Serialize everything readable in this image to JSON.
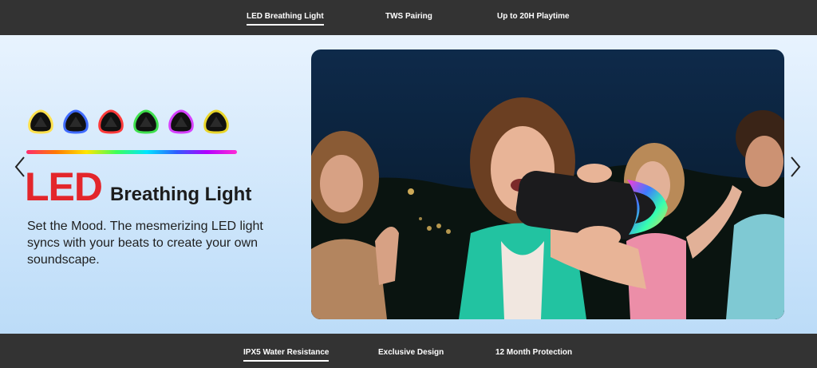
{
  "top_tabs": [
    {
      "label": "LED Breathing Light",
      "active": true
    },
    {
      "label": "TWS Pairing",
      "active": false
    },
    {
      "label": "Up to 20H Playtime",
      "active": false
    }
  ],
  "hero": {
    "headline_big": "LED",
    "headline_small": "Breathing Light",
    "description": "Set the Mood. The mesmerizing LED light syncs with your beats to create your own soundscape.",
    "icon_colors": [
      "#ffe14d",
      "#3f6bff",
      "#ff3a3a",
      "#3fe04d",
      "#d640ff",
      "#e8d52a"
    ],
    "prev_icon": "chevron-left-icon",
    "next_icon": "chevron-right-icon"
  },
  "bottom_tabs": [
    {
      "label": "IPX5 Water Resistance",
      "active": true
    },
    {
      "label": "Exclusive Design",
      "active": false
    },
    {
      "label": "12 Month Protection",
      "active": false
    }
  ],
  "colors": {
    "tab_bar": "#333333",
    "headline_red": "#e3262b"
  }
}
